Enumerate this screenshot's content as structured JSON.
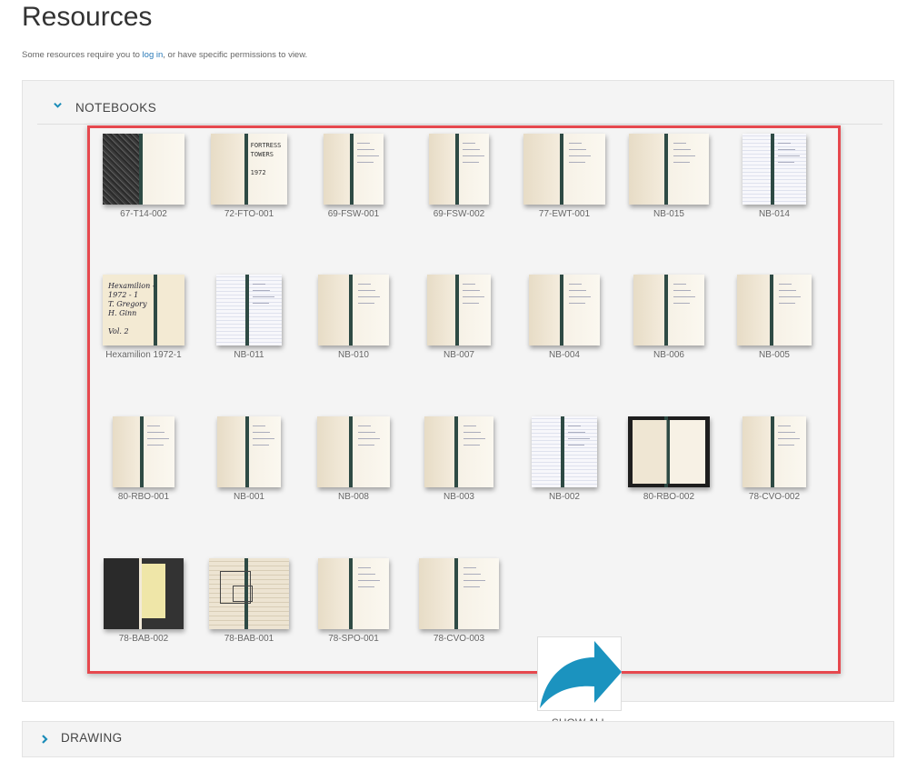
{
  "page": {
    "title": "Resources"
  },
  "notice": {
    "before": "Some resources require you to ",
    "link": "log in",
    "after": ", or have specific permissions to view."
  },
  "notebooks": {
    "title": "NOTEBOOKS",
    "items": [
      {
        "label": "67-T14-002",
        "style": "dark"
      },
      {
        "label": "72-FTO-001",
        "style": "cover",
        "cover_text": "FORTRESS\nTOWERS\n\n1972"
      },
      {
        "label": "69-FSW-001",
        "style": "plain"
      },
      {
        "label": "69-FSW-002",
        "style": "plain"
      },
      {
        "label": "77-EWT-001",
        "style": "plain"
      },
      {
        "label": "NB-015",
        "style": "plain"
      },
      {
        "label": "NB-014",
        "style": "grid"
      },
      {
        "label": "Hexamilion 1972-1",
        "style": "hand",
        "hand_text": "Hexamilion -\n1972 - 1\nT. Gregory\nH. Ginn\n\nVol. 2"
      },
      {
        "label": "NB-011",
        "style": "grid"
      },
      {
        "label": "NB-010",
        "style": "plain"
      },
      {
        "label": "NB-007",
        "style": "plain"
      },
      {
        "label": "NB-004",
        "style": "plain"
      },
      {
        "label": "NB-006",
        "style": "plain"
      },
      {
        "label": "NB-005",
        "style": "plain"
      },
      {
        "label": "80-RBO-001",
        "style": "plain"
      },
      {
        "label": "NB-001",
        "style": "plain"
      },
      {
        "label": "NB-008",
        "style": "plain"
      },
      {
        "label": "NB-003",
        "style": "plain"
      },
      {
        "label": "NB-002",
        "style": "grid"
      },
      {
        "label": "80-RBO-002",
        "style": "darkcover"
      },
      {
        "label": "78-CVO-002",
        "style": "plain"
      },
      {
        "label": "78-BAB-002",
        "style": "yellow"
      },
      {
        "label": "78-BAB-001",
        "style": "sketch"
      },
      {
        "label": "78-SPO-001",
        "style": "plain"
      },
      {
        "label": "78-CVO-003",
        "style": "plain"
      }
    ],
    "show_all_label": "SHOW ALL"
  },
  "drawing": {
    "title": "DRAWING"
  },
  "colors": {
    "accent": "#1a8cb8",
    "highlight_border": "#e6484e",
    "link": "#2a7ab8",
    "arrow": "#1b93bf"
  },
  "icons": {
    "notebooks_toggle": "chevron-down-icon",
    "drawing_toggle": "chevron-right-icon",
    "show_all": "curved-arrow-icon"
  }
}
